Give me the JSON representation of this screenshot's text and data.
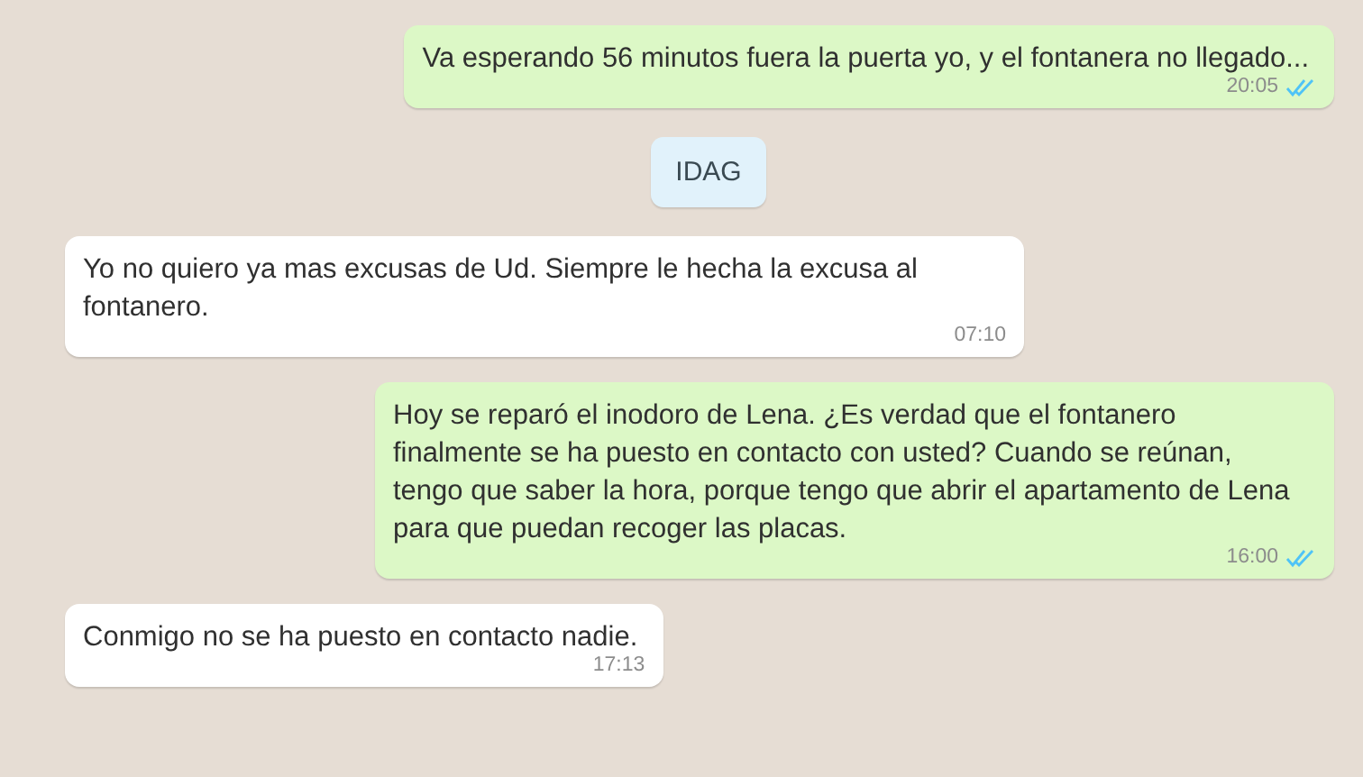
{
  "messages": [
    {
      "kind": "out",
      "text": "Va esperando 56 minutos fuera la puerta yo, y el fontanera no llegado...",
      "time": "20:05",
      "read": true
    },
    {
      "kind": "date",
      "text": "IDAG"
    },
    {
      "kind": "in",
      "text": "Yo no quiero ya mas excusas de Ud. Siempre le hecha la excusa al fontanero.",
      "time": "07:10"
    },
    {
      "kind": "out",
      "text": "Hoy se reparó el inodoro de Lena. ¿Es verdad que el fontanero finalmente se ha puesto en contacto con usted? Cuando se reúnan, tengo que saber la hora, porque tengo que abrir el apartamento de Lena para que puedan recoger las placas.",
      "time": "16:00",
      "read": true
    },
    {
      "kind": "in",
      "text": "Conmigo no se ha puesto en contacto nadie.",
      "time": "17:13"
    }
  ]
}
